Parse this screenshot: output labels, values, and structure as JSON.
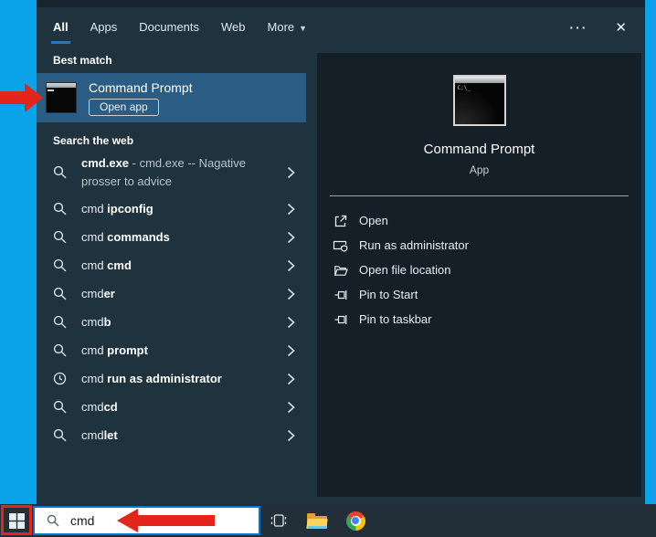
{
  "window": {
    "tabs": [
      "All",
      "Apps",
      "Documents",
      "Web",
      "More"
    ],
    "more_caret": "▼",
    "overflow": "···",
    "close": "✕"
  },
  "best_match": {
    "header": "Best match",
    "title": "Command Prompt",
    "open_app": "Open app",
    "icon": "command-prompt-icon"
  },
  "search_web": {
    "header": "Search the web",
    "items": [
      {
        "pre": "",
        "bold": "cmd.exe",
        "post": " - cmd.exe -- Nagative prosser to advice",
        "icon": "search-icon"
      },
      {
        "pre": "cmd ",
        "bold": "ipconfig",
        "post": "",
        "icon": "search-icon"
      },
      {
        "pre": "cmd ",
        "bold": "commands",
        "post": "",
        "icon": "search-icon"
      },
      {
        "pre": "cmd ",
        "bold": "cmd",
        "post": "",
        "icon": "search-icon"
      },
      {
        "pre": "cmd",
        "bold": "er",
        "post": "",
        "icon": "search-icon"
      },
      {
        "pre": "cmd",
        "bold": "b",
        "post": "",
        "icon": "search-icon"
      },
      {
        "pre": "cmd ",
        "bold": "prompt",
        "post": "",
        "icon": "search-icon"
      },
      {
        "pre": "cmd ",
        "bold": "run as administrator",
        "post": "",
        "icon": "history-icon"
      },
      {
        "pre": "cmd",
        "bold": "cd",
        "post": "",
        "icon": "search-icon"
      },
      {
        "pre": "cmd",
        "bold": "let",
        "post": "",
        "icon": "search-icon"
      }
    ]
  },
  "preview": {
    "title": "Command Prompt",
    "subtitle": "App",
    "icon": "command-prompt-icon",
    "prompt_text": "C:\\_",
    "actions": [
      {
        "label": "Open",
        "icon": "open-icon"
      },
      {
        "label": "Run as administrator",
        "icon": "run-as-administrator-icon"
      },
      {
        "label": "Open file location",
        "icon": "open-file-location-icon"
      },
      {
        "label": "Pin to Start",
        "icon": "pin-icon"
      },
      {
        "label": "Pin to taskbar",
        "icon": "pin-icon"
      }
    ]
  },
  "taskbar": {
    "search_value": "cmd",
    "icons": [
      "start-icon",
      "task-view-icon",
      "file-explorer-icon",
      "chrome-icon"
    ]
  },
  "colors": {
    "accent_blue": "#0078d7",
    "desktop_blue": "#0aa3ea",
    "best_match_highlight": "#2b5c84",
    "window_bg": "#1e333e",
    "preview_bg": "#141f27",
    "taskbar_bg": "#222e38",
    "annotation_red": "#e4251b"
  }
}
